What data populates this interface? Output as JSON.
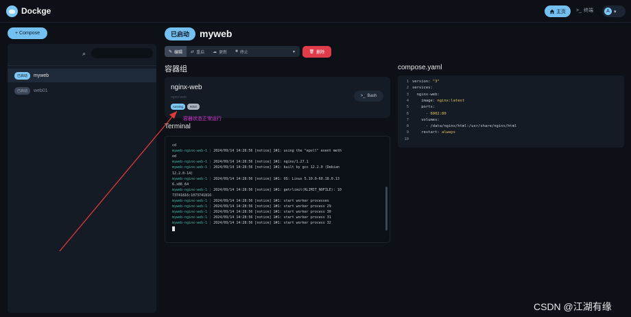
{
  "header": {
    "brand": "Dockge",
    "home_label": "主页",
    "console_label": "终端",
    "avatar_letter": "A"
  },
  "sidebar": {
    "compose_button": "+ Compose",
    "search_value": "",
    "items": [
      {
        "status": "已启动",
        "name": "myweb",
        "active": true
      },
      {
        "status": "已启动",
        "name": "web01",
        "active": false
      }
    ]
  },
  "stack": {
    "status": "已启动",
    "name": "myweb",
    "toolbar": {
      "edit": "编辑",
      "restart": "重启",
      "update": "更新",
      "stop": "停止",
      "delete": "删除"
    }
  },
  "sections": {
    "containers": "容器组",
    "compose": "compose.yaml",
    "terminal": "Terminal"
  },
  "container": {
    "name": "nginx-web",
    "subtitle": "nginx-web",
    "status": "running",
    "port": "6002",
    "bash_label": "Bash"
  },
  "annotation": "容器状态正常运行",
  "terminal_lines": [
    {
      "src": "",
      "msg": "cd"
    },
    {
      "src": "myweb-nginx-web-1",
      "msg": "2024/09/14 14:28:56 [notice] 1#1: using the \"epoll\" event meth"
    },
    {
      "src": "",
      "msg": "od"
    },
    {
      "src": "myweb-nginx-web-1",
      "msg": "2024/09/14 14:28:56 [notice] 1#1: nginx/1.27.1"
    },
    {
      "src": "myweb-nginx-web-1",
      "msg": "2024/09/14 14:28:56 [notice] 1#1: built by gcc 12.2.0 (Debian"
    },
    {
      "src": "",
      "msg": "12.2.0-14)"
    },
    {
      "src": "myweb-nginx-web-1",
      "msg": "2024/09/14 14:28:56 [notice] 1#1: OS: Linux 5.10.0-60.18.0.13"
    },
    {
      "src": "",
      "msg": "6.x86_64"
    },
    {
      "src": "myweb-nginx-web-1",
      "msg": "2024/09/14 14:28:56 [notice] 1#1: getrlimit(RLIMIT_NOFILE): 10"
    },
    {
      "src": "",
      "msg": "73741816:1073741816"
    },
    {
      "src": "myweb-nginx-web-1",
      "msg": "2024/09/14 14:28:56 [notice] 1#1: start worker processes"
    },
    {
      "src": "myweb-nginx-web-1",
      "msg": "2024/09/14 14:28:56 [notice] 1#1: start worker process 29"
    },
    {
      "src": "myweb-nginx-web-1",
      "msg": "2024/09/14 14:28:56 [notice] 1#1: start worker process 30"
    },
    {
      "src": "myweb-nginx-web-1",
      "msg": "2024/09/14 14:28:56 [notice] 1#1: start worker process 31"
    },
    {
      "src": "myweb-nginx-web-1",
      "msg": "2024/09/14 14:28:56 [notice] 1#1: start worker process 32"
    }
  ],
  "yaml_lines": [
    {
      "n": "1",
      "code": "version: \"3\""
    },
    {
      "n": "2",
      "code": "services:"
    },
    {
      "n": "3",
      "code": "  nginx-web:"
    },
    {
      "n": "4",
      "code": "    image: nginx:latest"
    },
    {
      "n": "5",
      "code": "    ports:"
    },
    {
      "n": "6",
      "code": "      - 6002:80"
    },
    {
      "n": "7",
      "code": "    volumes:"
    },
    {
      "n": "8",
      "code": "      - /data/nginx/html:/usr/share/nginx/html"
    },
    {
      "n": "9",
      "code": "    restart: always"
    },
    {
      "n": "10",
      "code": ""
    }
  ],
  "watermark": "CSDN @江湖有缘",
  "colors": {
    "background": "#0d1117",
    "accent": "#74c0f0",
    "danger": "#e23b4a",
    "annotation": "#d63ad6",
    "arrow": "#e03a3a",
    "log_source": "#3fb6a4"
  }
}
